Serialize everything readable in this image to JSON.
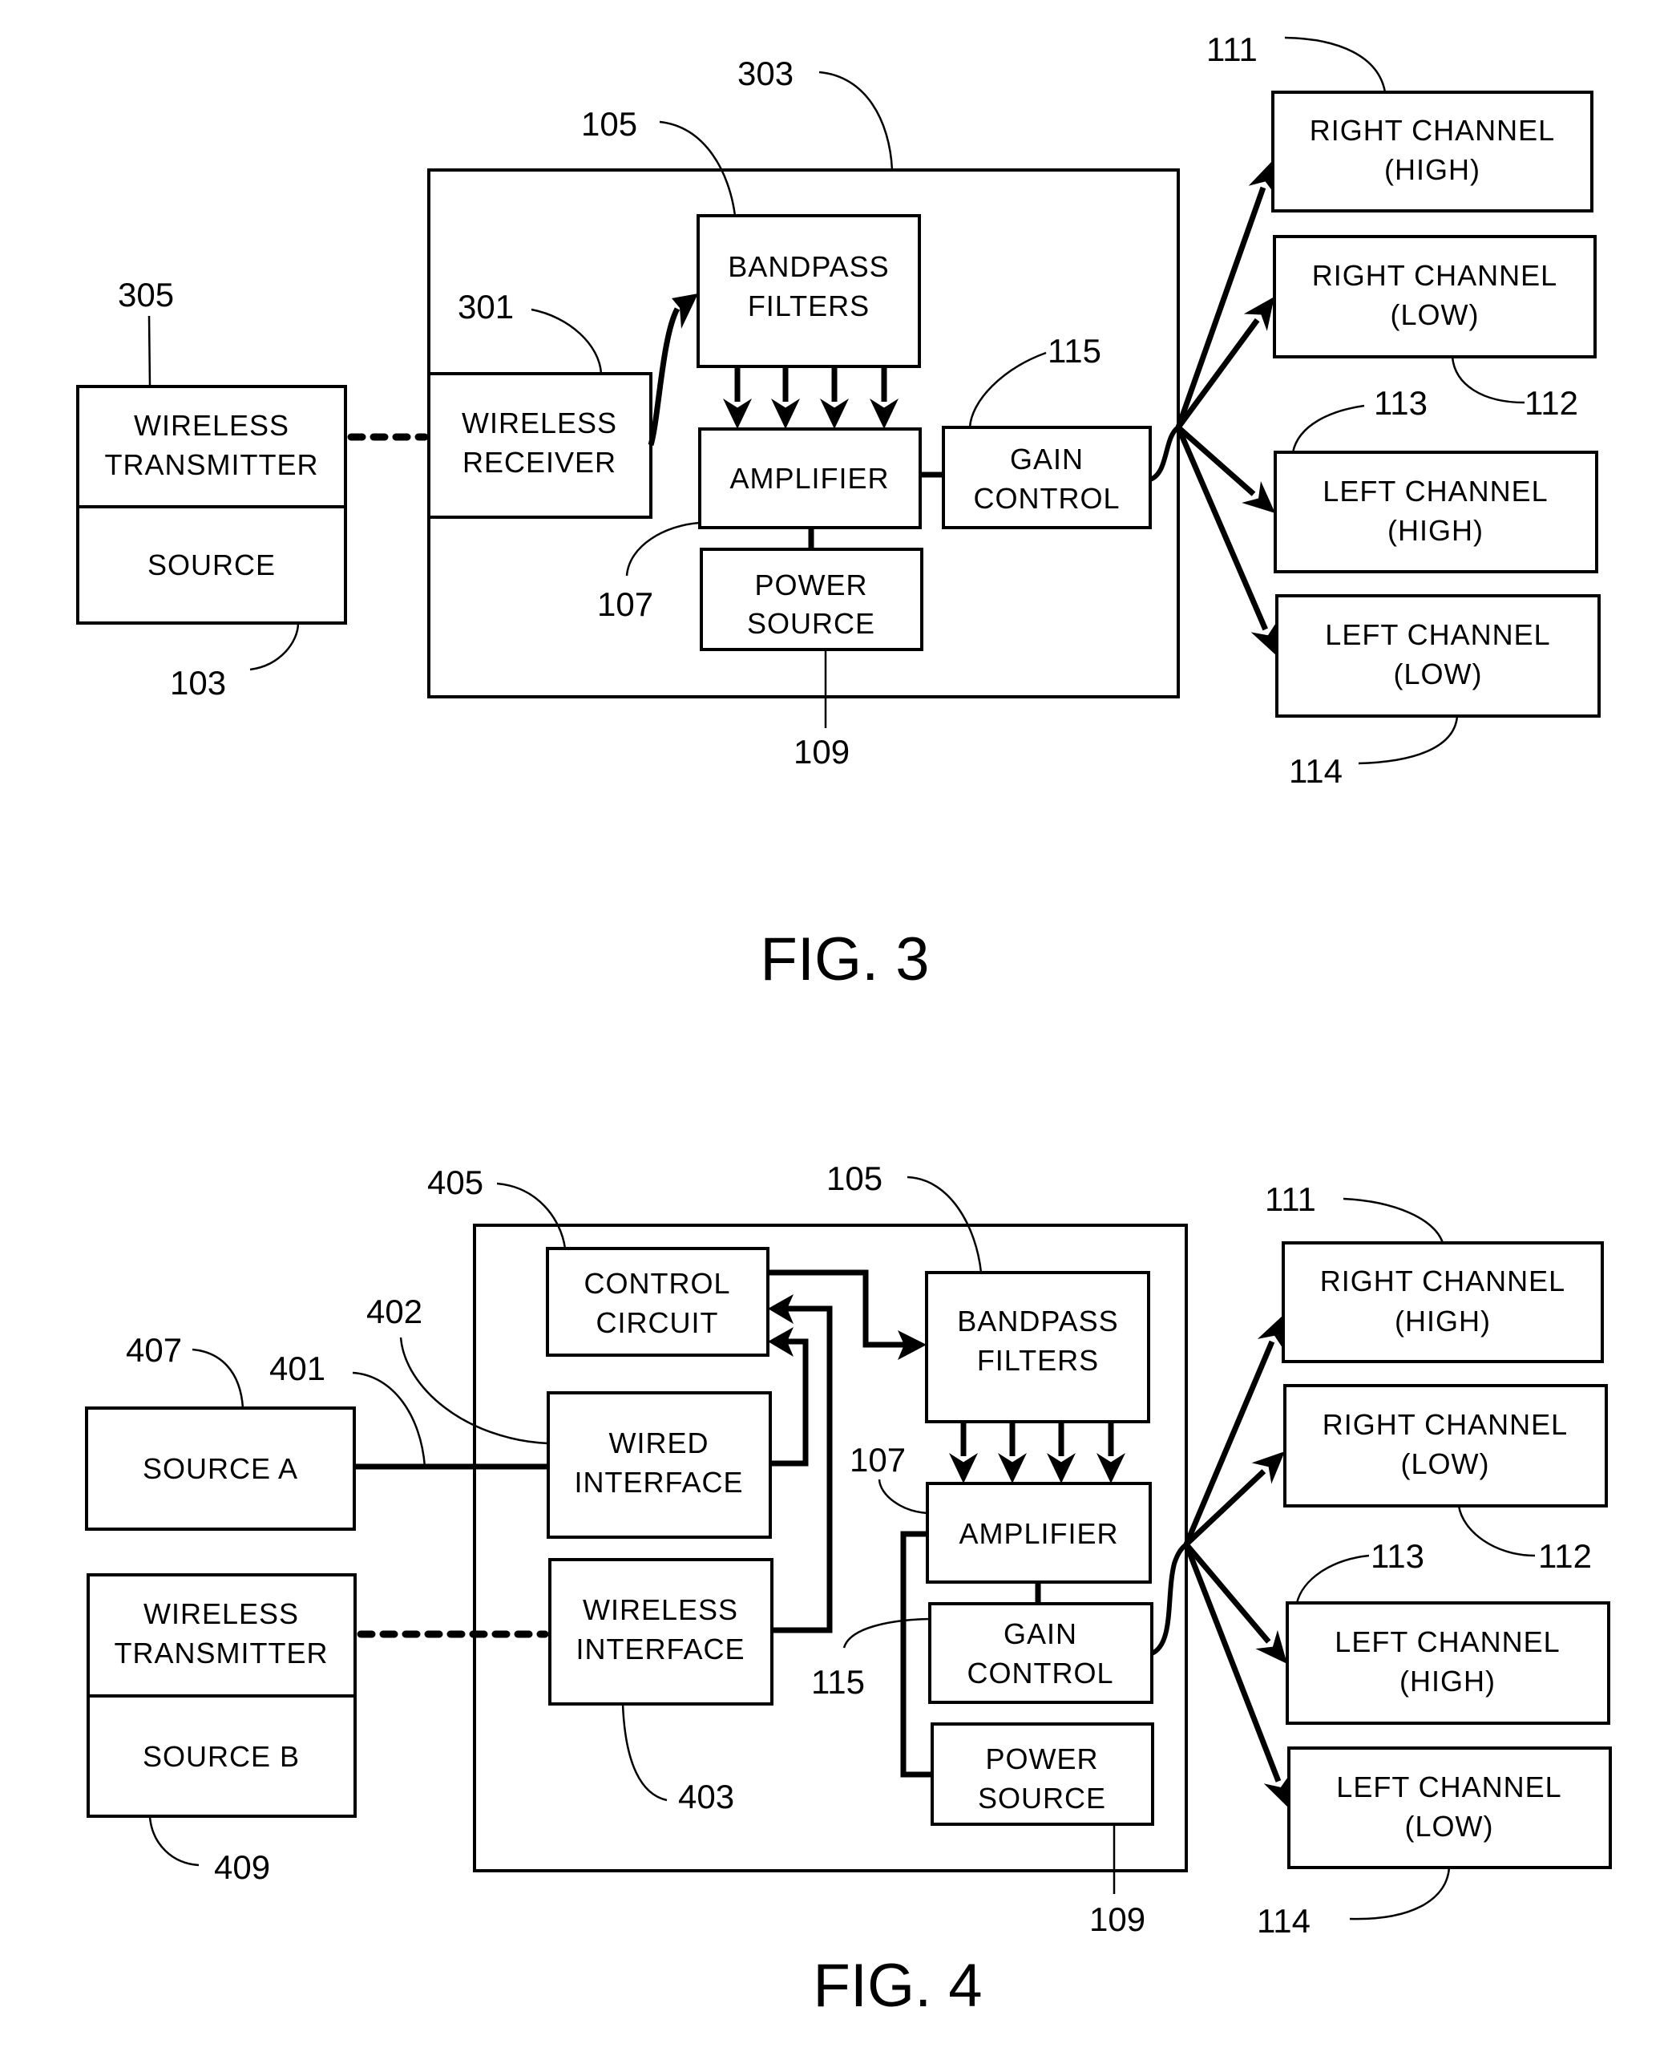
{
  "figure3": {
    "caption": "FIG. 3",
    "blocks": {
      "wireless_transmitter": [
        "WIRELESS",
        "TRANSMITTER"
      ],
      "source": [
        "SOURCE"
      ],
      "wireless_receiver": [
        "WIRELESS",
        "RECEIVER"
      ],
      "bandpass_filters": [
        "BANDPASS",
        "FILTERS"
      ],
      "amplifier": [
        "AMPLIFIER"
      ],
      "power_source": [
        "POWER",
        "SOURCE"
      ],
      "gain_control": [
        "GAIN",
        "CONTROL"
      ],
      "right_channel_high": [
        "RIGHT CHANNEL",
        "(HIGH)"
      ],
      "right_channel_low": [
        "RIGHT CHANNEL",
        "(LOW)"
      ],
      "left_channel_high": [
        "LEFT CHANNEL",
        "(HIGH)"
      ],
      "left_channel_low": [
        "LEFT CHANNEL",
        "(LOW)"
      ]
    },
    "refs": {
      "r305": "305",
      "r103": "103",
      "r303": "303",
      "r105": "105",
      "r301": "301",
      "r107": "107",
      "r109": "109",
      "r115": "115",
      "r111": "111",
      "r112": "112",
      "r113": "113",
      "r114": "114"
    }
  },
  "figure4": {
    "caption": "FIG. 4",
    "blocks": {
      "source_a": [
        "SOURCE A"
      ],
      "wireless_transmitter": [
        "WIRELESS",
        "TRANSMITTER"
      ],
      "source_b": [
        "SOURCE B"
      ],
      "control_circuit": [
        "CONTROL",
        "CIRCUIT"
      ],
      "wired_interface": [
        "WIRED",
        "INTERFACE"
      ],
      "wireless_interface": [
        "WIRELESS",
        "INTERFACE"
      ],
      "bandpass_filters": [
        "BANDPASS",
        "FILTERS"
      ],
      "amplifier": [
        "AMPLIFIER"
      ],
      "gain_control": [
        "GAIN",
        "CONTROL"
      ],
      "power_source": [
        "POWER",
        "SOURCE"
      ],
      "right_channel_high": [
        "RIGHT CHANNEL",
        "(HIGH)"
      ],
      "right_channel_low": [
        "RIGHT CHANNEL",
        "(LOW)"
      ],
      "left_channel_high": [
        "LEFT CHANNEL",
        "(HIGH)"
      ],
      "left_channel_low": [
        "LEFT CHANNEL",
        "(LOW)"
      ]
    },
    "refs": {
      "r405": "405",
      "r402": "402",
      "r407": "407",
      "r401": "401",
      "r403": "403",
      "r409": "409",
      "r105": "105",
      "r107": "107",
      "r115": "115",
      "r109": "109",
      "r111": "111",
      "r112": "112",
      "r113": "113",
      "r114": "114"
    }
  }
}
